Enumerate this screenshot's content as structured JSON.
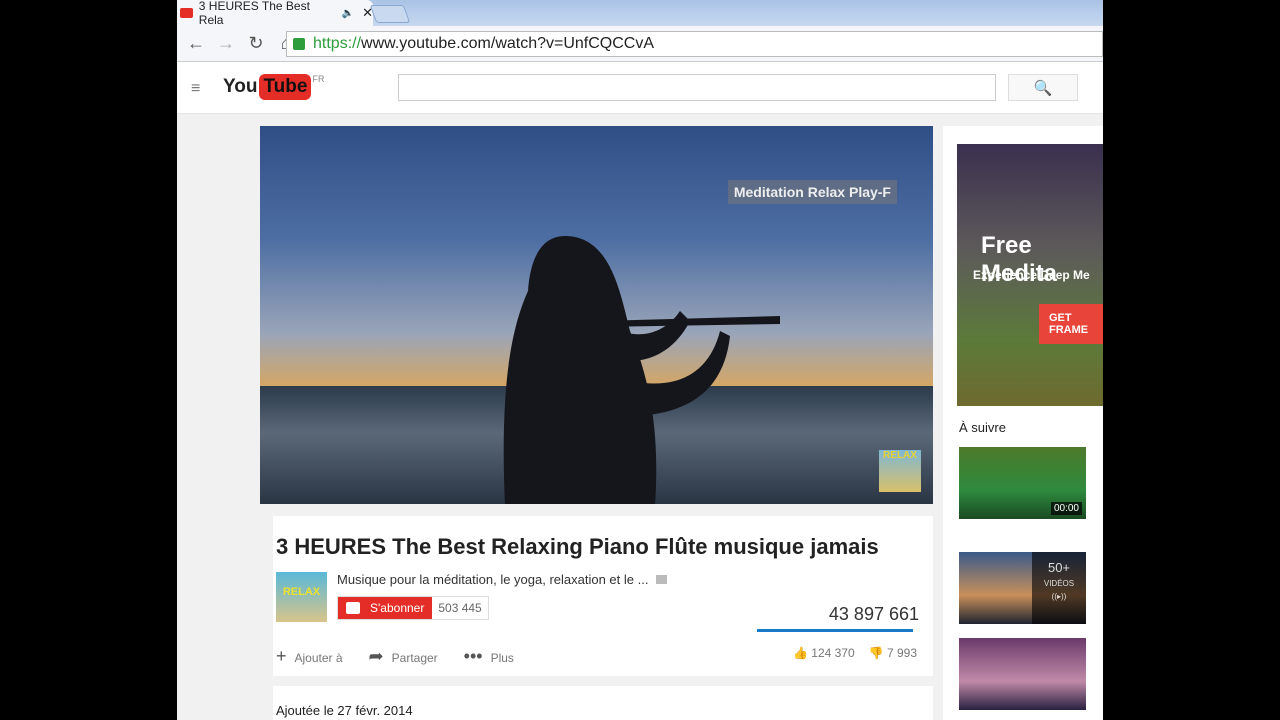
{
  "browser": {
    "tab_title": "3 HEURES The Best Rela",
    "url_scheme": "https://",
    "url_rest": "www.youtube.com/watch?v=UnfCQCCvA"
  },
  "youtube": {
    "logo_you": "You",
    "logo_tube": "Tube",
    "region": "FR",
    "search_placeholder": ""
  },
  "video": {
    "overlay_title": "Meditation Relax Play-F",
    "watermark": "RELAX",
    "title": "3 HEURES The Best Relaxing Piano Flûte musique jamais",
    "channel_name": "Musique pour la méditation, le yoga, relaxation et le ...",
    "channel_thumb_text": "RELAX",
    "subscribe_label": "S'abonner",
    "subscriber_count": "503 445",
    "views": "43 897 661",
    "actions": {
      "add": "Ajouter à",
      "share": "Partager",
      "more": "Plus"
    },
    "likes": "124 370",
    "dislikes": "7 993",
    "published": "Ajoutée le 27 févr. 2014"
  },
  "sidebar": {
    "ad": {
      "title": "Free Medita",
      "subtitle": "Experience Deep Me",
      "cta": "GET FRAME"
    },
    "up_next_label": "À suivre",
    "items": [
      {
        "duration": "00:00"
      },
      {
        "playlist_count": "50+",
        "playlist_label": "VIDÉOS"
      },
      {}
    ]
  }
}
